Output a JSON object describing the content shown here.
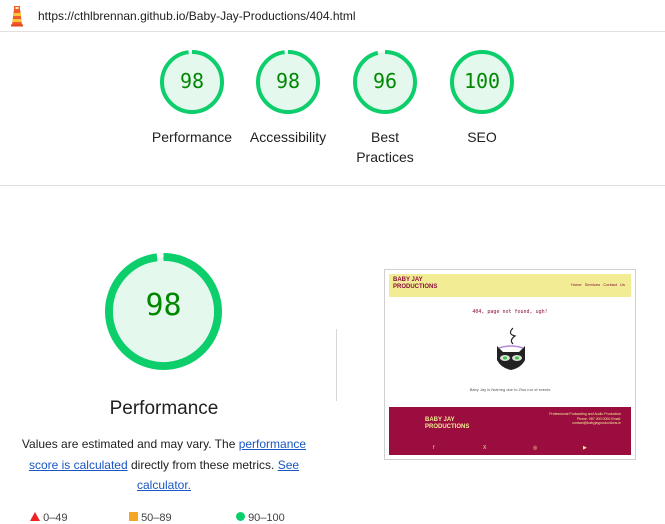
{
  "header": {
    "url": "https://cthlbrennan.github.io/Baby-Jay-Productions/404.html"
  },
  "gauges": [
    {
      "score": "98",
      "label": "Performance",
      "fraction": 0.98
    },
    {
      "score": "98",
      "label": "Accessibility",
      "fraction": 0.98
    },
    {
      "score": "96",
      "label": "Best Practices",
      "fraction": 0.96
    },
    {
      "score": "100",
      "label": "SEO",
      "fraction": 1.0
    }
  ],
  "colors": {
    "pass": "#0cce6b",
    "pass_fill": "#e5f8ee",
    "pass_text": "#008800",
    "link": "#1a56c4"
  },
  "performance": {
    "score": "98",
    "fraction": 0.98,
    "title": "Performance",
    "desc_before": "Values are estimated and may vary. The ",
    "link1": "performance score is calculated",
    "desc_middle": " directly from these metrics. ",
    "link2": "See calculator."
  },
  "legend": {
    "fail": "0–49",
    "average": "50–89",
    "pass": "90–100"
  },
  "screenshot": {
    "brand": "BABY JAY PRODUCTIONS",
    "nav": "Home Services Contact Us",
    "message": "404, page not found, ugh!",
    "sub": "Baby Jay is Nutmeg due to Zlus run of events",
    "footer_brand": "BABY JAY PRODUCTIONS",
    "footer_info": "Professional Podcasting and Audio Production Phone: 087 000 0000 Email: contact@babyjayproductions.ie",
    "footer_icons": [
      "f",
      "X",
      "◎",
      "▶"
    ]
  }
}
